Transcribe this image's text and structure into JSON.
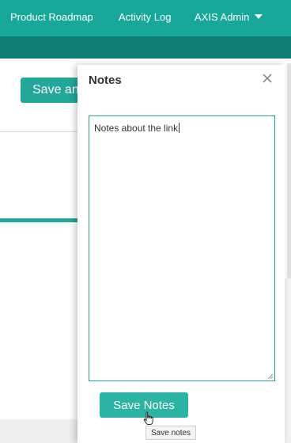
{
  "nav": {
    "links": [
      {
        "label": "Product Roadmap"
      },
      {
        "label": "Activity Log"
      },
      {
        "label": "AXIS Admin"
      }
    ]
  },
  "background": {
    "save_button_label": "Save an"
  },
  "notes_panel": {
    "title": "Notes",
    "textarea_value": "Notes about the link",
    "save_button_label": "Save Notes",
    "tooltip": "Save notes"
  },
  "colors": {
    "accent": "#17a89a",
    "accent_dark": "#0f7e72",
    "button": "#2bb3a4"
  }
}
